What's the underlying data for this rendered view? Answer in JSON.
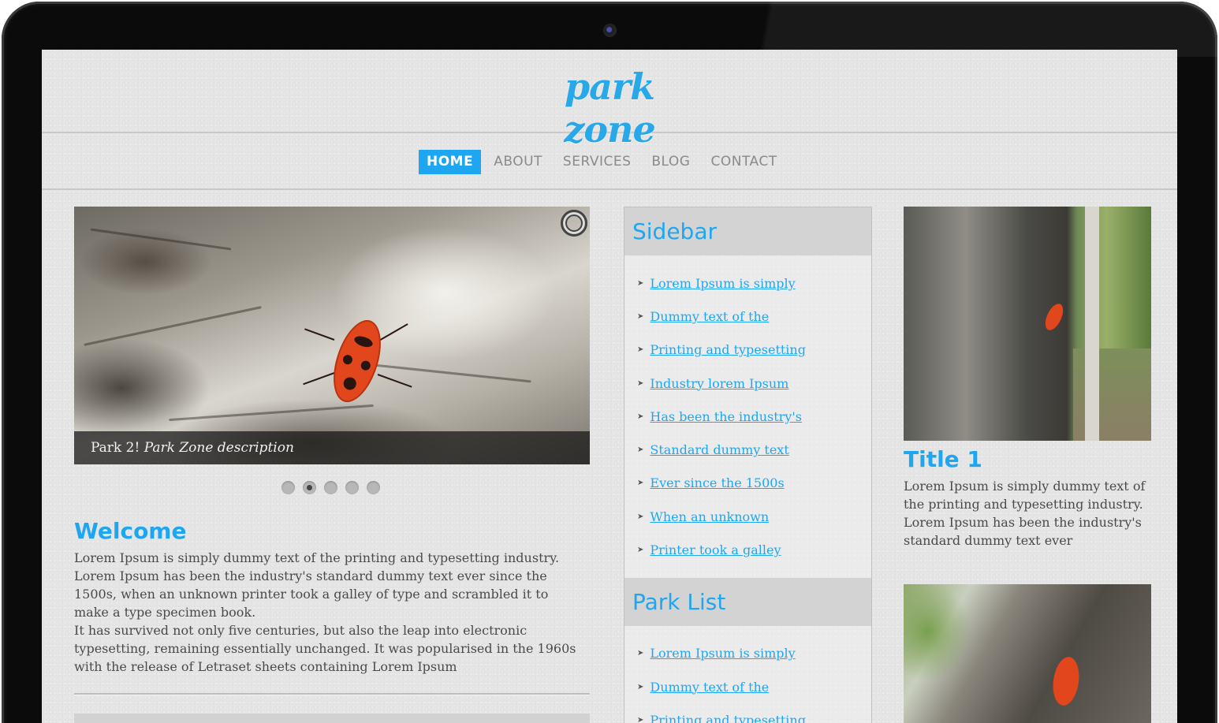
{
  "site": {
    "logo": "park zone",
    "brand_color": "#1ea7f0"
  },
  "nav": {
    "items": [
      {
        "label": "HOME",
        "active": true
      },
      {
        "label": "ABOUT",
        "active": false
      },
      {
        "label": "SERVICES",
        "active": false
      },
      {
        "label": "BLOG",
        "active": false
      },
      {
        "label": "CONTACT",
        "active": false
      }
    ]
  },
  "slider": {
    "caption_prefix": "Park 2!",
    "caption_italic": "Park Zone description",
    "dots": 5,
    "active_dot": 2
  },
  "welcome": {
    "title": "Welcome",
    "paragraph1": "Lorem Ipsum is simply dummy text of the printing and typesetting industry. Lorem Ipsum has been the industry's standard dummy text ever since the 1500s, when an unknown printer took a galley of type and scrambled it to make a type specimen book.",
    "paragraph2": "It has survived not only five centuries, but also the leap into electronic typesetting, remaining essentially unchanged. It was popularised in the 1960s with the release of Letraset sheets containing Lorem Ipsum"
  },
  "sidebar": {
    "title": "Sidebar",
    "links": [
      "Lorem Ipsum is simply",
      "Dummy text of the",
      "Printing and typesetting",
      "Industry lorem Ipsum",
      "Has been the industry's",
      "Standard dummy text",
      "Ever since the 1500s",
      "When an unknown",
      "Printer took a galley"
    ]
  },
  "park_list": {
    "title": "Park List",
    "links": [
      "Lorem Ipsum is simply",
      "Dummy text of the",
      "Printing and typesetting"
    ]
  },
  "feature": {
    "title": "Title 1",
    "text": "Lorem Ipsum is simply dummy text of the printing and typesetting industry. Lorem Ipsum has been the industry's standard dummy text ever"
  }
}
